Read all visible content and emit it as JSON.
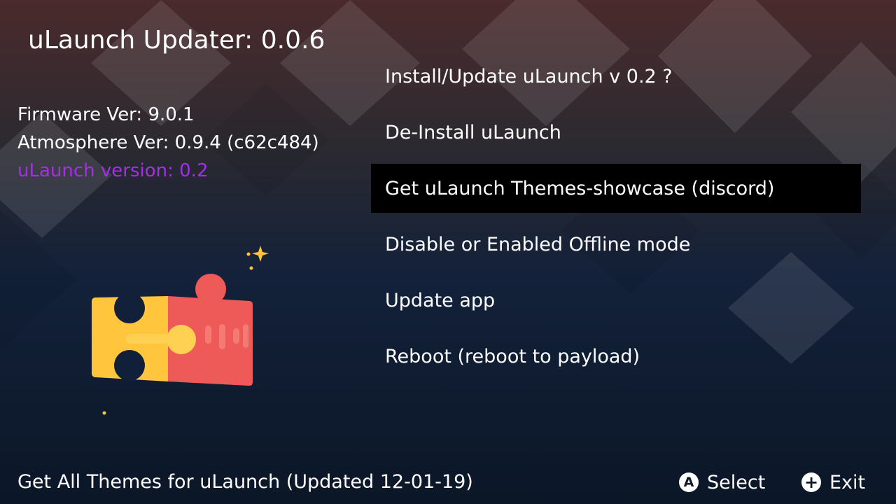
{
  "header": {
    "title": "uLaunch Updater: 0.0.6"
  },
  "info": {
    "firmware": "Firmware Ver: 9.0.1",
    "atmosphere": "Atmosphere Ver: 0.9.4 (c62c484)",
    "ulaunch_version": "uLaunch version: 0.2"
  },
  "menu": {
    "items": [
      {
        "label": "Install/Update uLaunch v 0.2 ?"
      },
      {
        "label": "De-Install uLaunch"
      },
      {
        "label": "Get uLaunch Themes-showcase (discord)"
      },
      {
        "label": "Disable or Enabled Offline mode"
      },
      {
        "label": "Update app"
      },
      {
        "label": "Reboot (reboot to payload)"
      }
    ],
    "selected_index": 2
  },
  "footer": {
    "status": "Get All Themes for uLaunch (Updated 12-01-19)",
    "select": {
      "glyph": "A",
      "label": "Select"
    },
    "exit": {
      "glyph": "+",
      "label": "Exit"
    }
  },
  "colors": {
    "accent": "#a230e6",
    "highlight": "#000000",
    "puzzle_yellow": "#ffc53d",
    "puzzle_red": "#ee5a57"
  },
  "icons": {
    "logo": "puzzle-pieces-icon",
    "sparkle": "sparkle-icon",
    "button_a": "a-button-icon",
    "button_plus": "plus-button-icon"
  }
}
